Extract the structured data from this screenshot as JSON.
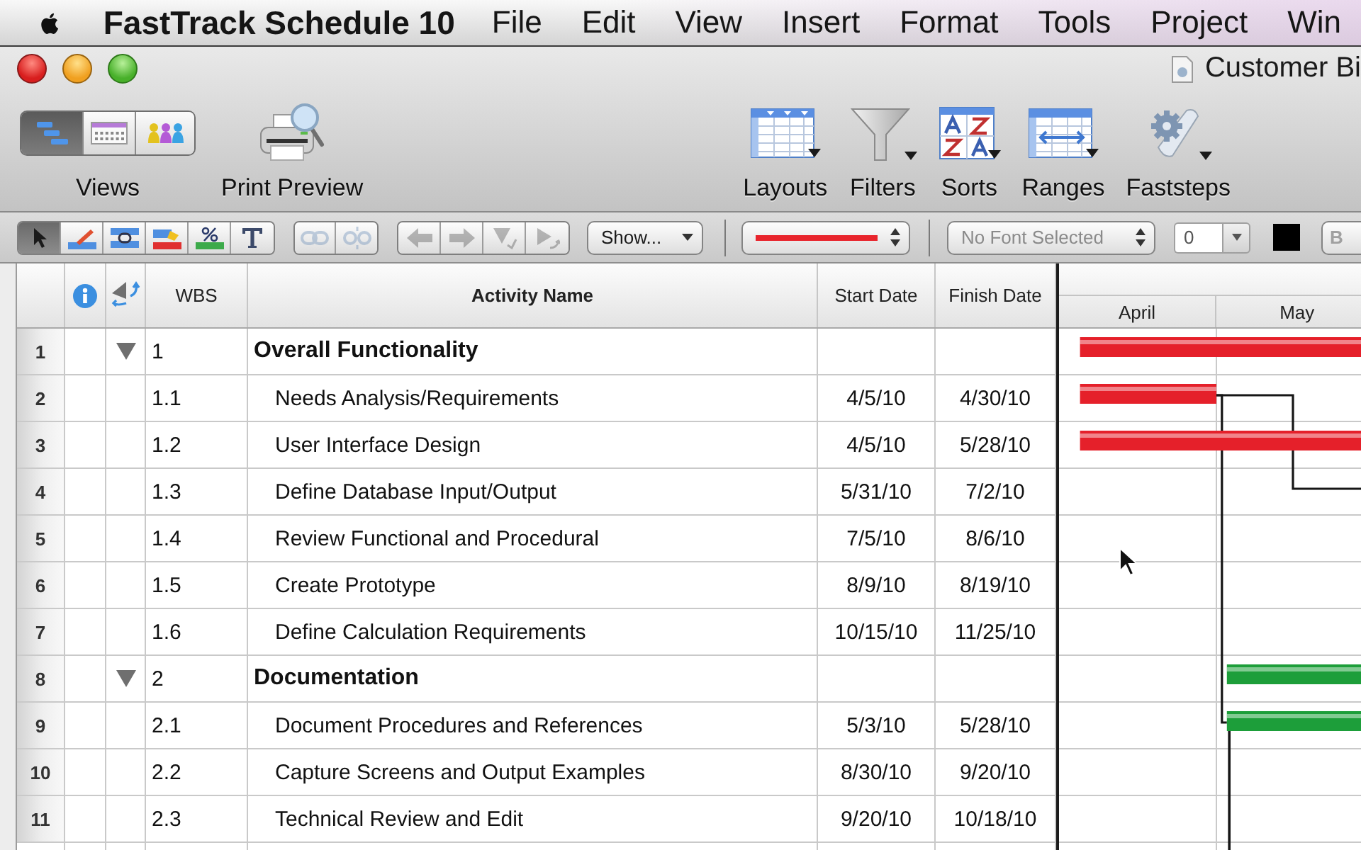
{
  "menu_bar": {
    "app_name": "FastTrack Schedule 10",
    "menus": [
      "File",
      "Edit",
      "View",
      "Insert",
      "Format",
      "Tools",
      "Project",
      "Win"
    ]
  },
  "window": {
    "title": "Customer Bi"
  },
  "toolbar": {
    "views": {
      "label": "Views",
      "options": [
        {
          "selected": true
        },
        {
          "selected": false
        },
        {
          "selected": false
        }
      ]
    },
    "print_preview": {
      "label": "Print Preview"
    },
    "items": [
      {
        "label": "Layouts",
        "has_menu": true
      },
      {
        "label": "Filters",
        "has_menu": true
      },
      {
        "label": "Sorts",
        "has_menu": true
      },
      {
        "label": "Ranges",
        "has_menu": true
      },
      {
        "label": "Faststeps",
        "has_menu": true
      }
    ]
  },
  "format_bar": {
    "tools": [
      {
        "selected": true
      },
      {
        "selected": false
      },
      {
        "selected": false
      },
      {
        "selected": false
      },
      {
        "selected": false
      },
      {
        "selected": false
      }
    ],
    "link_tools": [
      {
        "disabled": true
      },
      {
        "disabled": true
      }
    ],
    "outline_tools": [
      {
        "disabled": true
      },
      {
        "disabled": true
      },
      {
        "disabled": true
      },
      {
        "disabled": true
      }
    ],
    "show_menu": {
      "label": "Show..."
    },
    "line_style": {
      "color": "#e8242c"
    },
    "font": {
      "value": "No Font Selected",
      "disabled": true
    },
    "size": {
      "value": "0"
    },
    "text_color": {
      "color": "#000000"
    },
    "bold": {
      "label": "B",
      "disabled": true
    }
  },
  "table": {
    "columns": [
      "WBS",
      "Activity Name",
      "Start Date",
      "Finish Date"
    ],
    "rows": [
      {
        "number": "1",
        "wbs": "1",
        "name": "Overall Functionality",
        "expanded": true,
        "color": "#e5202a",
        "link_in": false,
        "link_out": false,
        "children": [
          {
            "number": "2",
            "wbs": "1.1",
            "name": "Needs Analysis/Requirements",
            "start": "4/5/10",
            "finish": "4/30/10",
            "color": "#e5202a",
            "link_in": false,
            "link_out": true
          },
          {
            "number": "3",
            "wbs": "1.2",
            "name": "User Interface Design",
            "start": "4/5/10",
            "finish": "5/28/10",
            "color": "#e5202a",
            "link_in": false,
            "link_out": false
          },
          {
            "number": "4",
            "wbs": "1.3",
            "name": "Define Database Input/Output",
            "start": "5/31/10",
            "finish": "7/2/10",
            "link_in": true,
            "link_out": false
          },
          {
            "number": "5",
            "wbs": "1.4",
            "name": "Review Functional and Procedural",
            "start": "7/5/10",
            "finish": "8/6/10",
            "link_in": false,
            "link_out": false
          },
          {
            "number": "6",
            "wbs": "1.5",
            "name": "Create Prototype",
            "start": "8/9/10",
            "finish": "8/19/10",
            "link_in": false,
            "link_out": false
          },
          {
            "number": "7",
            "wbs": "1.6",
            "name": "Define Calculation Requirements",
            "start": "10/15/10",
            "finish": "11/25/10",
            "link_in": false,
            "link_out": false
          }
        ]
      },
      {
        "number": "8",
        "wbs": "2",
        "name": "Documentation",
        "expanded": true,
        "color": "#1d9e3a",
        "link_in": false,
        "link_out": false,
        "children": [
          {
            "number": "9",
            "wbs": "2.1",
            "name": "Document Procedures and References",
            "start": "5/3/10",
            "finish": "5/28/10",
            "color": "#1d9e3a",
            "link_in": true,
            "link_out": true
          },
          {
            "number": "10",
            "wbs": "2.2",
            "name": "Capture Screens and Output Examples",
            "start": "8/30/10",
            "finish": "9/20/10",
            "link_in": false,
            "link_out": false
          },
          {
            "number": "11",
            "wbs": "2.3",
            "name": "Technical Review and Edit",
            "start": "9/20/10",
            "finish": "10/18/10",
            "link_in": false,
            "link_out": false
          }
        ]
      }
    ]
  },
  "gantt": {
    "months": [
      "April",
      "May"
    ]
  }
}
